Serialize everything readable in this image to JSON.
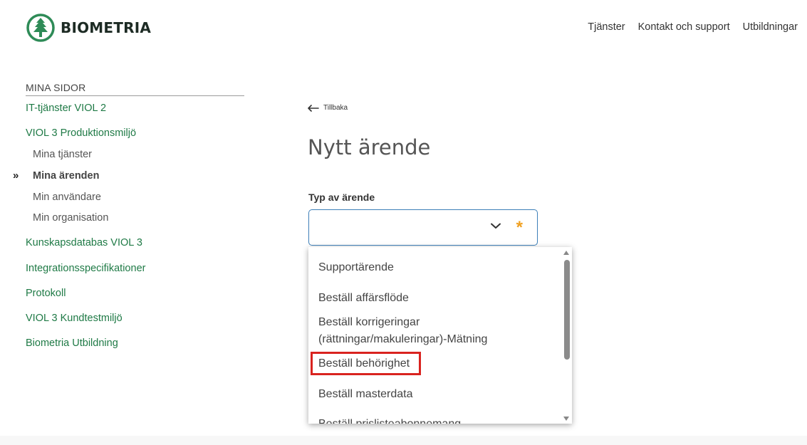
{
  "header": {
    "logo_text": "BIOMETRIA",
    "nav": [
      "Tjänster",
      "Kontakt och support",
      "Utbildningar"
    ]
  },
  "sidebar": {
    "title": "MINA SIDOR",
    "links": {
      "it_viol2": "IT-tjänster VIOL 2",
      "viol3_prod": "VIOL 3 Produktionsmiljö",
      "mina_tjanster": "Mina tjänster",
      "mina_arenden": "Mina ärenden",
      "min_anvandare": "Min användare",
      "min_organisation": "Min organisation",
      "kunskapsdatabas": "Kunskapsdatabas VIOL 3",
      "integrationsspec": "Integrationsspecifikationer",
      "protokoll": "Protokoll",
      "kundtestmiljo": "VIOL 3 Kundtestmiljö",
      "utbildning": "Biometria Utbildning"
    },
    "active_marker": "»"
  },
  "main": {
    "back_label": "Tillbaka",
    "title": "Nytt ärende",
    "field_label": "Typ av ärende",
    "required_mark": "*"
  },
  "dropdown": {
    "options": [
      "Supportärende",
      "Beställ affärsflöde",
      "Beställ korrigeringar",
      "(rättningar/makuleringar)-Mätning",
      "Beställ behörighet",
      "Beställ masterdata",
      "Beställ prislisteabonnemang"
    ]
  },
  "colors": {
    "brand_green": "#2e8b57",
    "link_green": "#1f7a46",
    "focus_blue": "#3d7fb8",
    "required_orange": "#f0a020",
    "highlight_red": "#d9231f"
  }
}
